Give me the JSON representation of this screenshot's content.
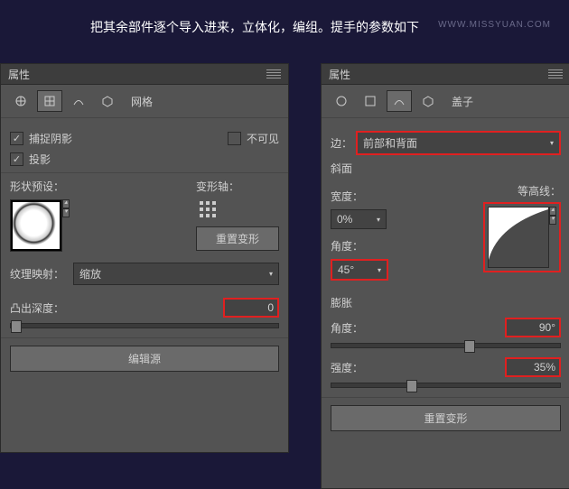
{
  "caption": "把其余部件逐个导入进来，立体化，编组。提手的参数如下",
  "watermark": "WWW.MISSYUAN.COM",
  "left": {
    "title": "属性",
    "mode_label": "网格",
    "catch_shadow": "捕捉阴影",
    "invisible": "不可见",
    "projection": "投影",
    "shape_preset": "形状预设：",
    "deform_axis": "变形轴：",
    "reset_deform": "重置变形",
    "texture_map": "纹理映射：",
    "texture_value": "缩放",
    "extrude_depth": "凸出深度：",
    "extrude_value": "0",
    "edit_source": "编辑源"
  },
  "right": {
    "title": "属性",
    "mode_label": "盖子",
    "edge": "边：",
    "edge_value": "前部和背面",
    "bevel": "斜面",
    "width": "宽度：",
    "width_value": "0%",
    "contour": "等高线：",
    "angle": "角度：",
    "angle_value": "45°",
    "inflate": "膨胀",
    "inflate_angle": "角度：",
    "inflate_angle_value": "90°",
    "strength": "强度：",
    "strength_value": "35%",
    "reset_deform": "重置变形"
  }
}
